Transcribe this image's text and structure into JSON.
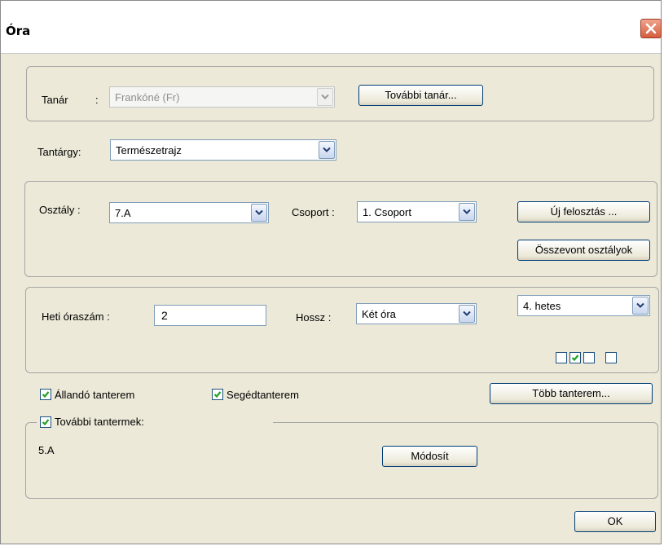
{
  "window": {
    "title": "Óra"
  },
  "teacher": {
    "label": "Tanár",
    "colon": ":",
    "value": "Frankóné (Fr)",
    "more_button": "További tanár..."
  },
  "subject": {
    "label": "Tantárgy:",
    "value": "Természetrajz"
  },
  "class_group": {
    "class_label": "Osztály :",
    "class_value": "7.A",
    "group_label": "Csoport :",
    "group_value": "1. Csoport",
    "new_split_button": "Új felosztás ...",
    "merged_button": "Összevont osztályok"
  },
  "hours": {
    "weekly_label": "Heti óraszám :",
    "weekly_value": "2",
    "length_label": "Hossz :",
    "length_value": "Két óra",
    "week_value": "4. hetes",
    "week_checks": [
      false,
      true,
      false,
      false
    ]
  },
  "rooms": {
    "fixed_room": {
      "label": "Állandó tanterem",
      "checked": true
    },
    "aux_room": {
      "label": "Segédtanterem",
      "checked": true
    },
    "more_rooms_button": "Több tanterem...",
    "additional": {
      "label": "További tantermek:",
      "checked": true
    },
    "list_value": "5.A",
    "modify_button": "Módosít"
  },
  "ok_button": "OK"
}
